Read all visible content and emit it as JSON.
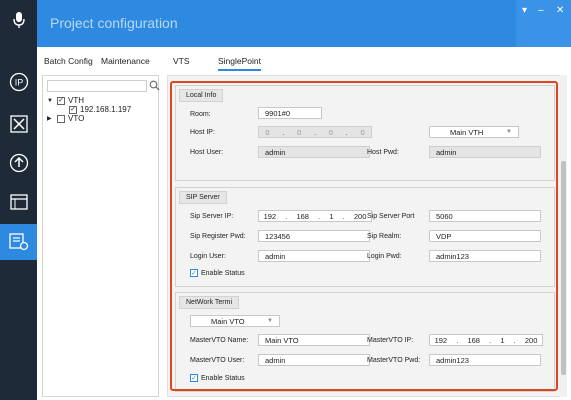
{
  "app": {
    "title": "Project configuration"
  },
  "window_controls": {
    "menu": "▾",
    "minimize": "–",
    "close": "✕"
  },
  "rail": {
    "icons": [
      "microphone-icon",
      "ip-icon",
      "tools-icon",
      "upload-icon",
      "window-icon",
      "config-icon"
    ],
    "active_icon": "config-icon",
    "active_color": "#2d8ae0"
  },
  "tabs": [
    "Batch Config",
    "Maintenance",
    "VTS",
    "SinglePoint"
  ],
  "active_tab": "SinglePoint",
  "tree": {
    "search_value": "",
    "nodes": [
      {
        "label": "VTH",
        "checked": true,
        "expanded": true
      },
      {
        "label": "192.168.1.197",
        "checked": true,
        "child": true
      },
      {
        "label": "VTO",
        "checked": false,
        "expanded": false
      }
    ]
  },
  "local_info": {
    "header": "Local Info",
    "room_label": "Room:",
    "room_value": "9901#0",
    "host_ip_label": "Host IP:",
    "host_ip": [
      "0",
      "0",
      "0",
      "0"
    ],
    "device_select": "Main VTH",
    "host_user_label": "Host User:",
    "host_user_value": "admin",
    "host_pwd_label": "Host Pwd:",
    "host_pwd_value": "admin"
  },
  "sip_server": {
    "header": "SIP Server",
    "server_ip_label": "Sip Server IP:",
    "server_ip": [
      "192",
      "168",
      "1",
      "200"
    ],
    "server_port_label": "Sip Server Port",
    "server_port_value": "5060",
    "register_pwd_label": "Sip Register Pwd:",
    "register_pwd_value": "123456",
    "realm_label": "Sip Realm:",
    "realm_value": "VDP",
    "login_user_label": "Login User:",
    "login_user_value": "admin",
    "login_pwd_label": "Login Pwd:",
    "login_pwd_value": "admin123",
    "enable_label": "Enable Status",
    "enabled": true
  },
  "network_terminal": {
    "header": "NetWork Termi",
    "vto_select": "Main VTO",
    "master_name_label": "MasterVTO Name:",
    "master_name_value": "Main VTO",
    "master_ip_label": "MasterVTO IP:",
    "master_ip": [
      "192",
      "168",
      "1",
      "200"
    ],
    "master_user_label": "MasterVTO User:",
    "master_user_value": "admin",
    "master_pwd_label": "MasterVTO Pwd:",
    "master_pwd_value": "admin123",
    "enable_label": "Enable Status",
    "enabled": true
  },
  "colors": {
    "accent": "#2d8ae0",
    "rail": "#1e2a38",
    "highlight": "#e0451f"
  }
}
